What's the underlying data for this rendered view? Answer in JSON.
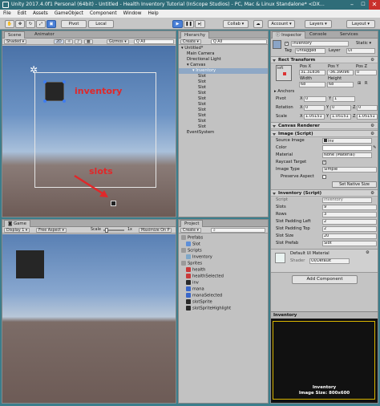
{
  "window": {
    "title": "Unity 2017.4.0f1 Personal (64bit) - Untitled - Health Inventory Tutorial (InScope Studios) - PC, Mac & Linux Standalone* <DX...",
    "minimize": "–",
    "maximize": "☐",
    "close": "✕"
  },
  "menu": [
    "File",
    "Edit",
    "Assets",
    "GameObject",
    "Component",
    "Window",
    "Help"
  ],
  "toolbar": {
    "pivot": "Pivot",
    "local": "Local",
    "collab": "Collab ▾",
    "account": "Account ▾",
    "layers": "Layers ▾",
    "layout": "Layout ▾"
  },
  "scene": {
    "tab_scene": "Scene",
    "tab_animator": "Animator",
    "shading": "Shaded ▾",
    "mode_2d": "2D",
    "gizmos": "Gizmos ▾",
    "search": "Q All",
    "annotation_inventory": "inventory",
    "annotation_slots": "slots"
  },
  "game": {
    "tab": "Game",
    "display": "Display 1 ▾",
    "aspect": "Free Aspect ▾",
    "scale_label": "Scale",
    "scale_value": "1x",
    "maximize": "Maximize On P"
  },
  "hierarchy": {
    "tab": "Hierarchy",
    "create": "Create ▾",
    "search": "Q All",
    "items": [
      {
        "label": "Untitled*",
        "depth": 0,
        "selected": false
      },
      {
        "label": "Main Camera",
        "depth": 1,
        "selected": false
      },
      {
        "label": "Directional Light",
        "depth": 1,
        "selected": false
      },
      {
        "label": "Canvas",
        "depth": 1,
        "selected": false
      },
      {
        "label": "Inventory",
        "depth": 2,
        "selected": true
      },
      {
        "label": "Slot",
        "depth": 3,
        "selected": false
      },
      {
        "label": "Slot",
        "depth": 3,
        "selected": false
      },
      {
        "label": "Slot",
        "depth": 3,
        "selected": false
      },
      {
        "label": "Slot",
        "depth": 3,
        "selected": false
      },
      {
        "label": "Slot",
        "depth": 3,
        "selected": false
      },
      {
        "label": "Slot",
        "depth": 3,
        "selected": false
      },
      {
        "label": "Slot",
        "depth": 3,
        "selected": false
      },
      {
        "label": "Slot",
        "depth": 3,
        "selected": false
      },
      {
        "label": "Slot",
        "depth": 3,
        "selected": false
      },
      {
        "label": "Slot",
        "depth": 3,
        "selected": false
      },
      {
        "label": "EventSystem",
        "depth": 1,
        "selected": false
      }
    ]
  },
  "project": {
    "tab": "Project",
    "create": "Create ▾",
    "items": [
      {
        "label": "Prefabs",
        "depth": 0,
        "kind": "folder"
      },
      {
        "label": "Slot",
        "depth": 1,
        "kind": "prefab"
      },
      {
        "label": "Scripts",
        "depth": 0,
        "kind": "folder"
      },
      {
        "label": "Inventory",
        "depth": 1,
        "kind": "script"
      },
      {
        "label": "Sprites",
        "depth": 0,
        "kind": "folder"
      },
      {
        "label": "health",
        "depth": 1,
        "kind": "sprite-red"
      },
      {
        "label": "healthSelected",
        "depth": 1,
        "kind": "sprite-red"
      },
      {
        "label": "inv",
        "depth": 1,
        "kind": "sprite-dark"
      },
      {
        "label": "mana",
        "depth": 1,
        "kind": "sprite-blue"
      },
      {
        "label": "manaSelected",
        "depth": 1,
        "kind": "sprite-blue"
      },
      {
        "label": "slotSprite",
        "depth": 1,
        "kind": "sprite-dark"
      },
      {
        "label": "slotSpriteHighlight",
        "depth": 1,
        "kind": "sprite-dark"
      }
    ]
  },
  "inspector": {
    "tabs": [
      "Inspector",
      "Console",
      "Services"
    ],
    "object_name": "Inventory",
    "static_label": "Static ▾",
    "tag_label": "Tag",
    "tag_value": "Untagged",
    "layer_label": "Layer",
    "layer_value": "UI",
    "rect_transform": {
      "title": "Rect Transform",
      "anchor_label": "left",
      "pos_x_label": "Pos X",
      "pos_y_label": "Pos Y",
      "pos_z_label": "Pos Z",
      "pos_x": "31.31836",
      "pos_y": "-36.39096",
      "pos_z": "0",
      "width_label": "Width",
      "height_label": "Height",
      "width": "68",
      "height": "68",
      "anchors_label": "Anchors",
      "pivot_label": "Pivot",
      "pivot_x": "0",
      "pivot_y": "1",
      "rotation_label": "Rotation",
      "rot_x": "0",
      "rot_y": "0",
      "rot_z": "0",
      "scale_label": "Scale",
      "scale_x": "1.05151",
      "scale_y": "1.05151",
      "scale_z": "1.05151",
      "axis_x": "X",
      "axis_y": "Y",
      "axis_z": "Z",
      "blueprint": "⊞",
      "raw": "R"
    },
    "canvas_renderer": {
      "title": "Canvas Renderer"
    },
    "image": {
      "title": "Image (Script)",
      "source_image_label": "Source Image",
      "source_image_value": "inv",
      "color_label": "Color",
      "material_label": "Material",
      "material_value": "None (Material)",
      "raycast_label": "Raycast Target",
      "image_type_label": "Image Type",
      "image_type_value": "Simple",
      "preserve_label": "Preserve Aspect",
      "native_size_button": "Set Native Size"
    },
    "inventory_script": {
      "title": "Inventory (Script)",
      "script_label": "Script",
      "script_value": "Inventory",
      "fields": [
        {
          "label": "Slots",
          "value": "9"
        },
        {
          "label": "Rows",
          "value": "3"
        },
        {
          "label": "Slot Padding Left",
          "value": "2"
        },
        {
          "label": "Slot Padding Top",
          "value": "2"
        },
        {
          "label": "Slot Size",
          "value": "20"
        },
        {
          "label": "Slot Prefab",
          "value": "Slot"
        }
      ]
    },
    "material": {
      "name": "Default UI Material",
      "shader_label": "Shader",
      "shader_value": "UI/Default"
    },
    "add_component": "Add Component",
    "preview": {
      "title": "Inventory",
      "caption_name": "Inventory",
      "caption_size": "Image Size: 800x600"
    }
  },
  "colors": {
    "accent_blue": "#4a7fd6",
    "annotation_red": "#e0282a",
    "selection": "#8ea8c6",
    "scene_sky_top": "#4f78ad",
    "scene_ground": "#6d5b56"
  }
}
